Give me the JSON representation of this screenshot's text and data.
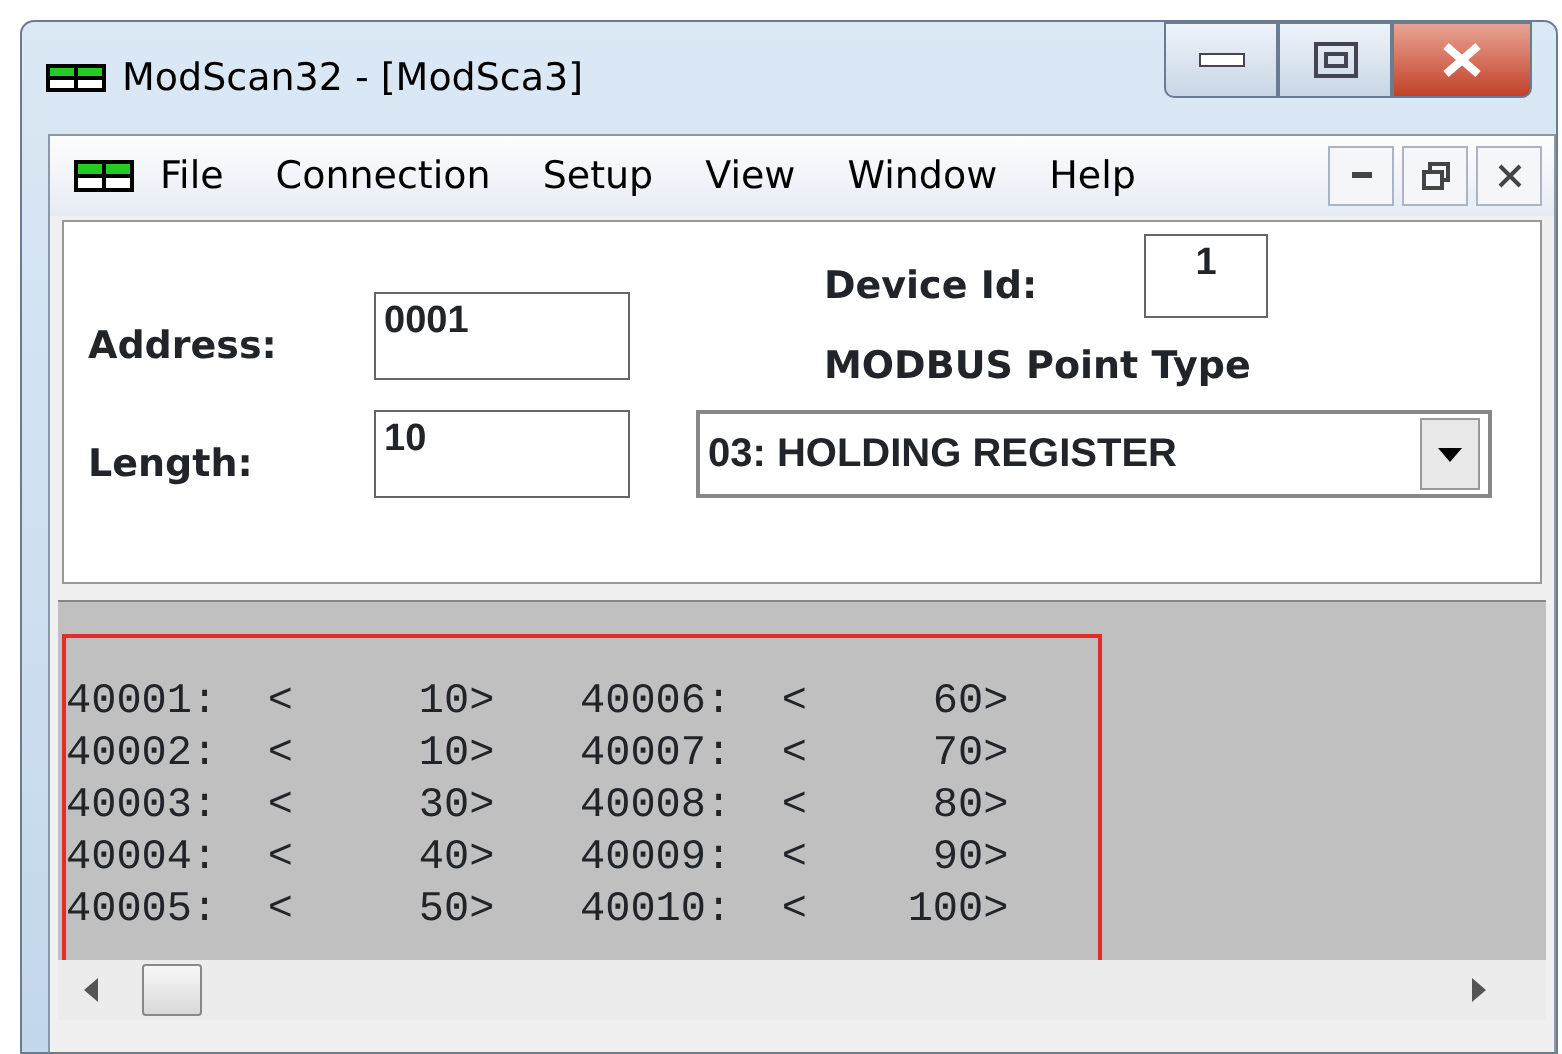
{
  "window": {
    "title": "ModScan32 - [ModSca3]"
  },
  "menu": [
    "File",
    "Connection",
    "Setup",
    "View",
    "Window",
    "Help"
  ],
  "form": {
    "address_label": "Address:",
    "address": "0001",
    "length_label": "Length:",
    "length": "10",
    "device_id_label": "Device Id:",
    "device_id": "1",
    "point_type_label": "MODBUS Point Type",
    "point_type": "03: HOLDING REGISTER"
  },
  "registers": [
    [
      "40001:  <     10>",
      "40006:  <     60>"
    ],
    [
      "40002:  <     10>",
      "40007:  <     70>"
    ],
    [
      "40003:  <     30>",
      "40008:  <     80>"
    ],
    [
      "40004:  <     40>",
      "40009:  <     90>"
    ],
    [
      "40005:  <     50>",
      "40010:  <    100>"
    ]
  ]
}
